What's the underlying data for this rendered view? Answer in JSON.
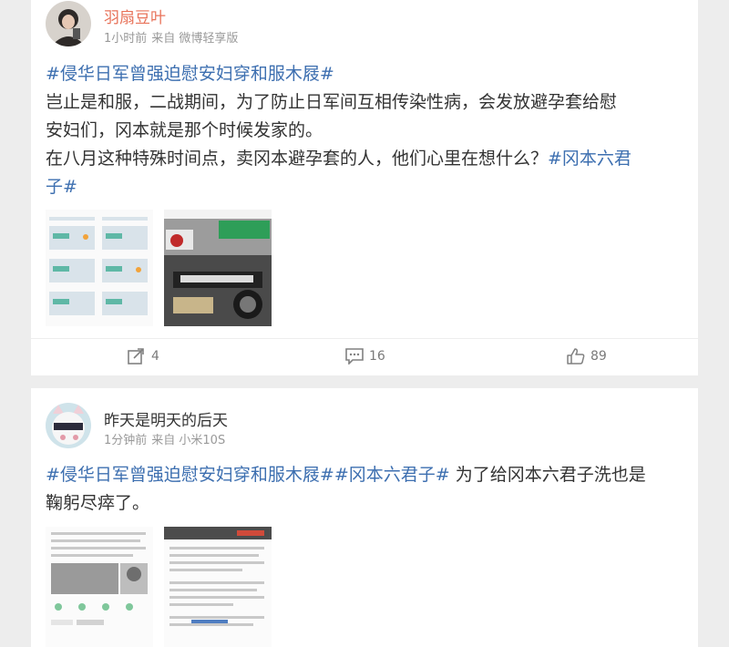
{
  "posts": [
    {
      "username": "羽扇豆叶",
      "time": "1小时前",
      "source": "来自 微博轻享版",
      "line1_tag": "#侵华日军曾强迫慰安妇穿和服木屐#",
      "line2": "岂止是和服，二战期间，为了防止日军间互相传染性病，会发放避孕套给慰",
      "line3": "安妇们，冈本就是那个时候发家的。",
      "line4_text": "在八月这种特殊时间点，卖冈本避孕套的人，他们心里在想什么？",
      "line4_tag": "#冈本六君",
      "line5_tag": "子#",
      "repost": "4",
      "comments": "16",
      "likes": "89",
      "colors": {
        "tag": "#3d6fb0",
        "username": "#e8735a"
      }
    },
    {
      "username": "昨天是明天的后天",
      "time": "1分钟前",
      "source": "来自 小米10S",
      "line1_tag1": "#侵华日军曾强迫慰安妇穿和服木屐#",
      "line1_tag2": "#冈本六君子#",
      "line1_text": " 为了给冈本六君子洗也是",
      "line2": "鞠躬尽瘁了。"
    }
  ],
  "icons": [
    "repost-icon",
    "comment-icon",
    "like-icon"
  ]
}
